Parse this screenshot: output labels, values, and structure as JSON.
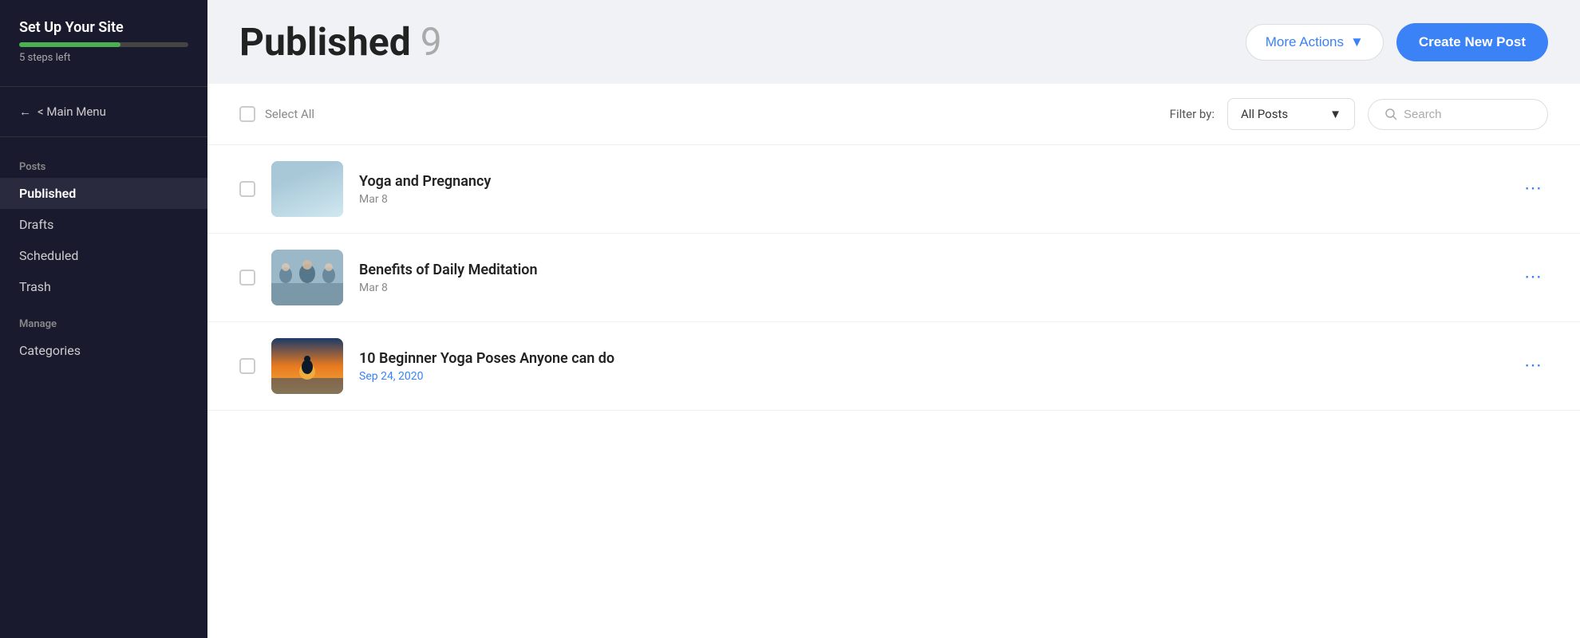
{
  "sidebar": {
    "setup_title": "Set Up Your Site",
    "steps_left": "5 steps left",
    "main_menu_label": "< Main Menu",
    "posts_section_label": "Posts",
    "nav_items": [
      {
        "id": "published",
        "label": "Published",
        "active": true
      },
      {
        "id": "drafts",
        "label": "Drafts",
        "active": false
      },
      {
        "id": "scheduled",
        "label": "Scheduled",
        "active": false
      },
      {
        "id": "trash",
        "label": "Trash",
        "active": false
      }
    ],
    "manage_section_label": "Manage",
    "manage_items": [
      {
        "id": "categories",
        "label": "Categories"
      }
    ]
  },
  "header": {
    "title": "Published",
    "count": "9",
    "more_actions_label": "More Actions",
    "create_post_label": "Create New Post"
  },
  "filter_bar": {
    "select_all_label": "Select All",
    "filter_by_label": "Filter by:",
    "filter_option": "All Posts",
    "search_placeholder": "Search"
  },
  "posts": [
    {
      "id": "yoga-pregnancy",
      "title": "Yoga and Pregnancy",
      "date": "Mar 8",
      "date_highlighted": false,
      "thumb_class": "thumb-yoga-pregnancy"
    },
    {
      "id": "daily-meditation",
      "title": "Benefits of Daily Meditation",
      "date": "Mar 8",
      "date_highlighted": false,
      "thumb_class": "thumb-meditation"
    },
    {
      "id": "beginner-yoga",
      "title": "10 Beginner Yoga Poses Anyone can do",
      "date": "Sep 24, 2020",
      "date_highlighted": true,
      "thumb_class": "thumb-beginner-yoga"
    }
  ]
}
